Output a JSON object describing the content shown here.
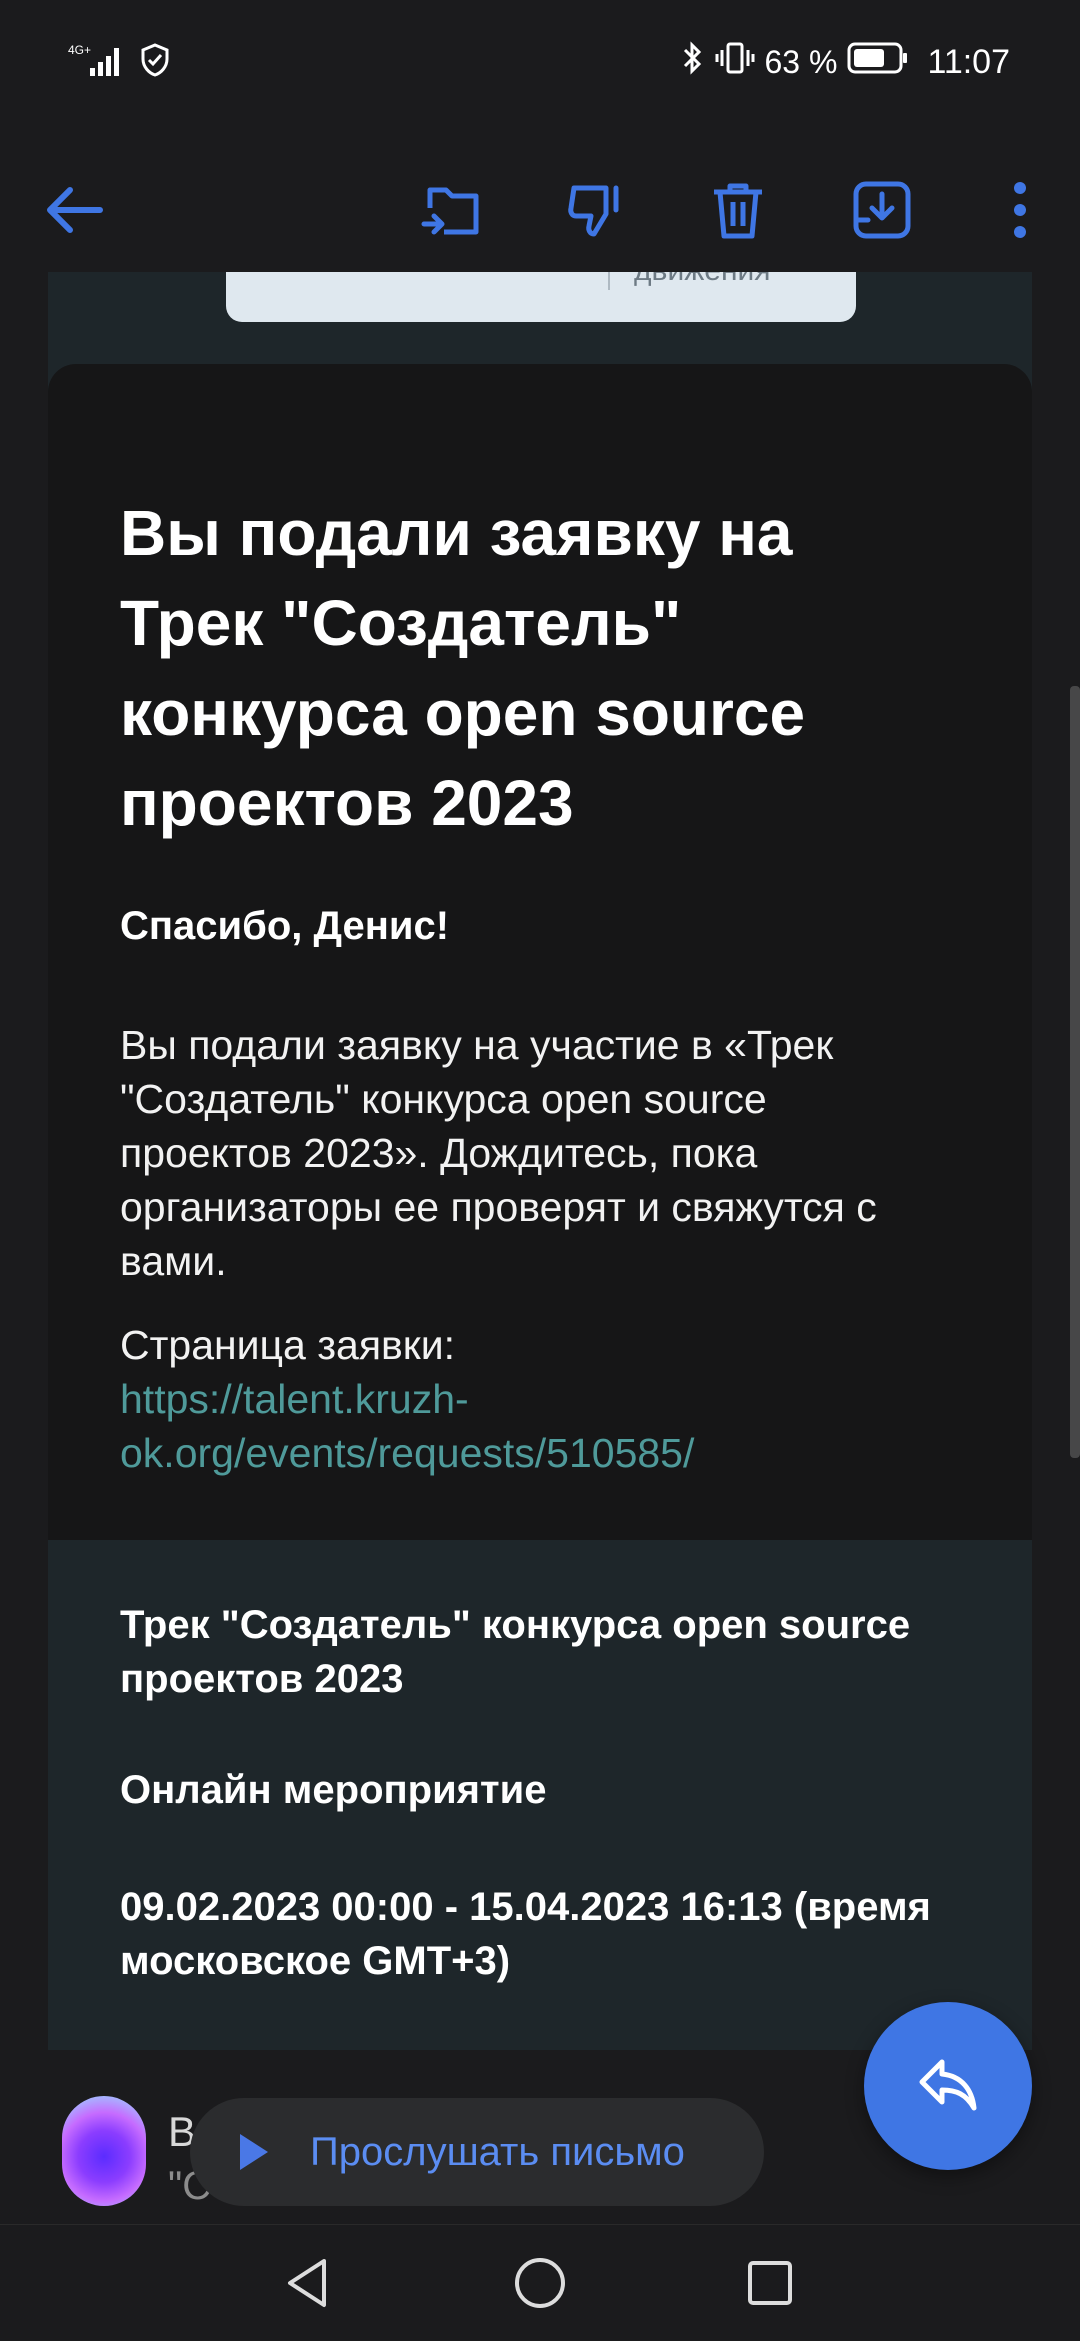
{
  "status_bar": {
    "network": "4G+",
    "battery_percent": "63 %",
    "time": "11:07"
  },
  "toolbar": {
    "back_icon": "arrow-left-icon",
    "move_icon": "folder-move-icon",
    "spam_icon": "thumb-down-icon",
    "delete_icon": "trash-icon",
    "archive_icon": "archive-download-icon",
    "more_icon": "more-vertical-icon",
    "accent_color": "#3f76e4"
  },
  "remnant": {
    "chip_text": "движения"
  },
  "email": {
    "title": "Вы подали заявку на Трек \"Создатель\" конкурса open source проектов 2023",
    "greeting": "Спасибо, Денис!",
    "body": "Вы подали заявку на участие в «Трек \"Создатель\" конкурса open source проектов 2023». Дождитесь, пока организаторы ее проверят и свяжутся с вами.",
    "request_label": "Страница заявки:",
    "request_link": "https://talent.kruzh-ok.org/events/requests/510585/",
    "link_color": "#4f9a9a"
  },
  "event_info": {
    "title": "Трек \"Создатель\" конкурса open source проектов 2023",
    "type": "Онлайн мероприятие",
    "dates": "09.02.2023 00:00 - 15.04.2023 16:13 (время московское GMT+3)"
  },
  "bottom": {
    "sender_initial": "В",
    "preview": "\"С                                 n source",
    "listen_label": "Прослушать письмо",
    "reply_icon": "reply-icon"
  },
  "navbar": {
    "back": "nav-back-icon",
    "home": "nav-home-icon",
    "recents": "nav-recents-icon"
  }
}
